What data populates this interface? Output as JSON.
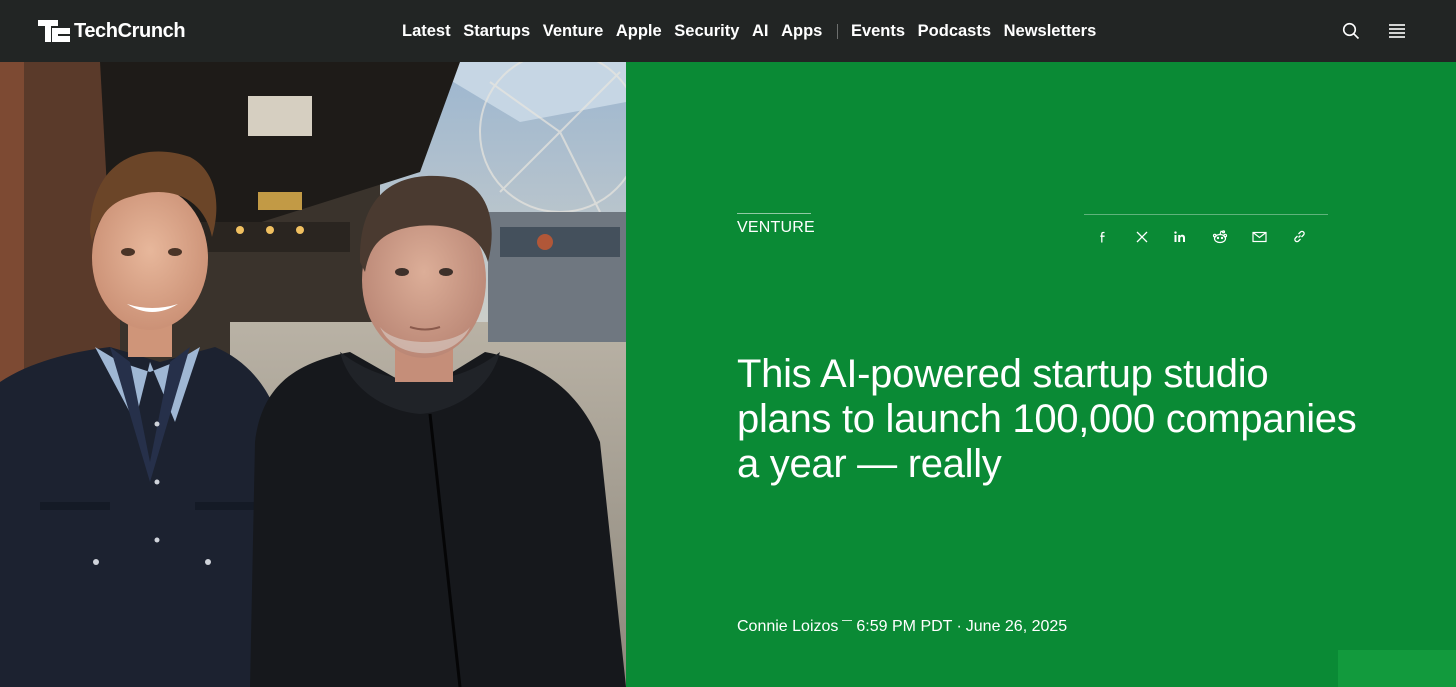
{
  "brand": {
    "name": "TechCrunch"
  },
  "nav": {
    "primary": [
      "Latest",
      "Startups",
      "Venture",
      "Apple",
      "Security",
      "AI",
      "Apps"
    ],
    "secondary": [
      "Events",
      "Podcasts",
      "Newsletters"
    ]
  },
  "header_icons": {
    "search": "search-icon",
    "menu": "hamburger-menu-icon"
  },
  "article": {
    "category": "VENTURE",
    "headline": "This AI-powered startup studio plans to launch 100,000 companies a year — really",
    "author": "Connie Loizos",
    "time": "6:59 PM PDT",
    "separator": "·",
    "date": "June 26, 2025"
  },
  "share_icons": [
    "facebook-icon",
    "x-icon",
    "linkedin-icon",
    "reddit-icon",
    "email-icon",
    "copy-link-icon"
  ],
  "colors": {
    "header_bg": "#222524",
    "accent_green": "#0a8a35",
    "text": "#ffffff"
  }
}
